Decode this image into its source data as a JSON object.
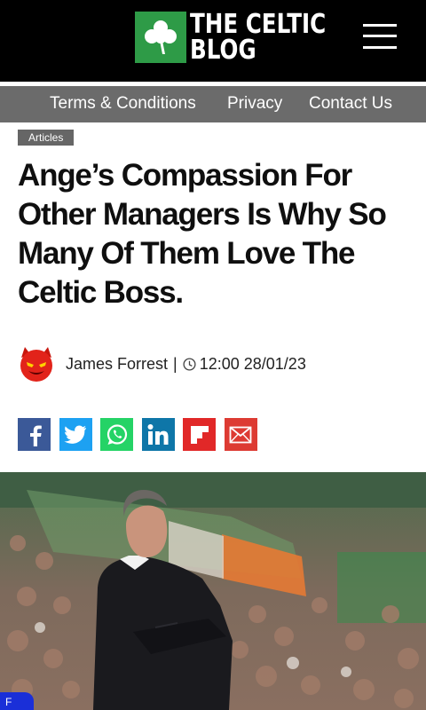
{
  "header": {
    "logo": {
      "line1": "THE CELTIC",
      "line2": "BLOG",
      "icon": "shamrock-icon",
      "color": "#2e9b47"
    },
    "menu_icon": "hamburger-menu-icon"
  },
  "nav": {
    "items": [
      {
        "label": "Terms & Conditions"
      },
      {
        "label": "Privacy"
      },
      {
        "label": "Contact Us"
      }
    ],
    "background": "#6b6b6b"
  },
  "article": {
    "category": "Articles",
    "title": "Ange’s Compassion For Other Managers Is Why So Many Of Them Love The Celtic Boss.",
    "author": {
      "name": "James Forrest",
      "separator": "|",
      "avatar_icon": "devil-face-icon",
      "time": "12:00 28/01/23",
      "time_icon": "clock-icon"
    },
    "share_buttons": [
      {
        "name": "facebook",
        "icon": "facebook-icon",
        "color": "#3b5998"
      },
      {
        "name": "twitter",
        "icon": "twitter-icon",
        "color": "#1da1f2"
      },
      {
        "name": "whatsapp",
        "icon": "whatsapp-icon",
        "color": "#25d366"
      },
      {
        "name": "linkedin",
        "icon": "linkedin-icon",
        "color": "#0e76a8"
      },
      {
        "name": "flipboard",
        "icon": "flipboard-icon",
        "color": "#e12828"
      },
      {
        "name": "email",
        "icon": "email-icon",
        "color": "#dd3b33"
      }
    ],
    "image": {
      "subject": "man in dark jumper with arms folded in front of crowd"
    }
  },
  "corner_tab": {
    "label": "F",
    "color": "#1a2fd8"
  }
}
